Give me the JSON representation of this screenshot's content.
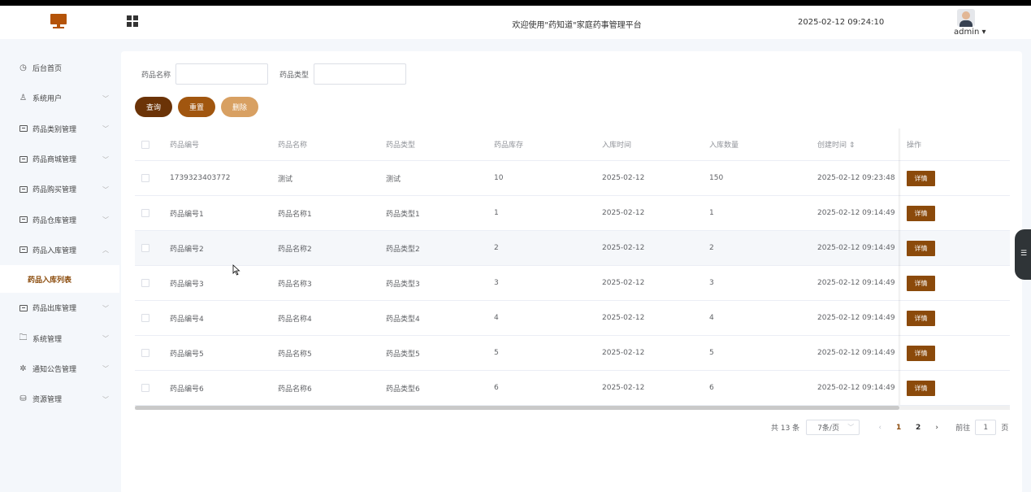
{
  "header": {
    "welcome": "欢迎使用\"药知道\"家庭药事管理平台",
    "datetime": "2025-02-12 09:24:10",
    "user": "admin ▾"
  },
  "sidebar": {
    "items": [
      {
        "label": "后台首页",
        "icon": "clock-icon",
        "chevron": ""
      },
      {
        "label": "系统用户",
        "icon": "user-icon",
        "chevron": "﹀"
      },
      {
        "label": "药品类别管理",
        "icon": "box-icon",
        "chevron": "﹀"
      },
      {
        "label": "药品商城管理",
        "icon": "box-icon",
        "chevron": "﹀"
      },
      {
        "label": "药品购买管理",
        "icon": "box-icon",
        "chevron": "﹀"
      },
      {
        "label": "药品仓库管理",
        "icon": "box-icon",
        "chevron": "﹀"
      },
      {
        "label": "药品入库管理",
        "icon": "box-icon",
        "chevron": "︿"
      },
      {
        "label": "药品出库管理",
        "icon": "box-icon",
        "chevron": "﹀"
      },
      {
        "label": "系统管理",
        "icon": "folder-icon",
        "chevron": "﹀"
      },
      {
        "label": "通知公告管理",
        "icon": "sun-icon",
        "chevron": "﹀"
      },
      {
        "label": "资源管理",
        "icon": "resource-icon",
        "chevron": "﹀"
      }
    ],
    "active_sub": "药品入库列表"
  },
  "search": {
    "name_label": "药品名称",
    "type_label": "药品类型"
  },
  "buttons": {
    "query": "查询",
    "reset": "重置",
    "delete": "删除"
  },
  "colors": {
    "query": "#6b3307",
    "reset": "#a1560f",
    "delete": "#d8a062",
    "detail": "#8b4a0b"
  },
  "table": {
    "headers": [
      "药品编号",
      "药品名称",
      "药品类型",
      "药品库存",
      "入库时间",
      "入库数量",
      "创建时间 ⇕",
      "操作"
    ],
    "detail_label": "详情",
    "rows": [
      [
        "1739323403772",
        "测试",
        "测试",
        "10",
        "2025-02-12",
        "150",
        "2025-02-12 09:23:48"
      ],
      [
        "药品编号1",
        "药品名称1",
        "药品类型1",
        "1",
        "2025-02-12",
        "1",
        "2025-02-12 09:14:49"
      ],
      [
        "药品编号2",
        "药品名称2",
        "药品类型2",
        "2",
        "2025-02-12",
        "2",
        "2025-02-12 09:14:49"
      ],
      [
        "药品编号3",
        "药品名称3",
        "药品类型3",
        "3",
        "2025-02-12",
        "3",
        "2025-02-12 09:14:49"
      ],
      [
        "药品编号4",
        "药品名称4",
        "药品类型4",
        "4",
        "2025-02-12",
        "4",
        "2025-02-12 09:14:49"
      ],
      [
        "药品编号5",
        "药品名称5",
        "药品类型5",
        "5",
        "2025-02-12",
        "5",
        "2025-02-12 09:14:49"
      ],
      [
        "药品编号6",
        "药品名称6",
        "药品类型6",
        "6",
        "2025-02-12",
        "6",
        "2025-02-12 09:14:49"
      ]
    ]
  },
  "pagination": {
    "total": "共 13 条",
    "page_size": "7条/页",
    "pages": [
      "1",
      "2"
    ],
    "goto_label": "前往",
    "goto_value": "1",
    "page_suffix": "页"
  }
}
